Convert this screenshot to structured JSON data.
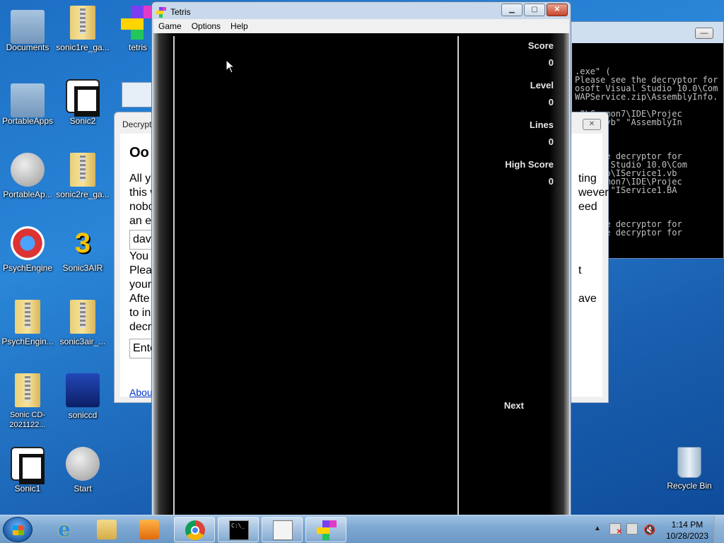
{
  "desktop": {
    "icons": [
      {
        "label": "Documents"
      },
      {
        "label": "sonic1re_ga..."
      },
      {
        "label": "tetris"
      },
      {
        "label": "PortableApps"
      },
      {
        "label": "Sonic2"
      },
      {
        "label": "PortableAp..."
      },
      {
        "label": "sonic2re_ga..."
      },
      {
        "label": "PsychEngine"
      },
      {
        "label": "Sonic3AIR"
      },
      {
        "label": "PsychEngin..."
      },
      {
        "label": "sonic3air_..."
      },
      {
        "label": "Sonic CD-2021122..."
      },
      {
        "label": "soniccd"
      },
      {
        "label": "Sonic1"
      },
      {
        "label": "Start"
      },
      {
        "label": "Recycle Bin"
      }
    ]
  },
  "console": {
    "lines": [
      ".exe\" (",
      "Please see the decryptor for",
      "osoft Visual Studio 10.0\\Com",
      "WAPService.zip\\AssemblyInfo.",
      "",
      ".0\\Common7\\IDE\\Projec",
      "yInfo.vb\" \"AssemblyIn",
      "",
      "",
      "(",
      "see the decryptor for",
      "Visual Studio 10.0\\Com",
      "ice.zip\\IService1.vb",
      ".0\\Common7\\IDE\\Projec",
      "e1.vb\" \"IService1.BA",
      "",
      "",
      "(",
      "see the decryptor for",
      "see the decryptor for"
    ]
  },
  "decryptor": {
    "title": "Decrypt",
    "heading": "Oo",
    "text_left": [
      "All yo",
      "this w",
      "nobo",
      "an e"
    ],
    "field1": "dave",
    "text_left2": [
      "You",
      "Plea",
      "your",
      "Afte",
      "to in",
      "decr"
    ],
    "field2": "Ente",
    "link": "Abou",
    "text_right": [
      "ting",
      "wever,",
      "eed",
      "",
      "",
      "t",
      "",
      "ave"
    ]
  },
  "tetris": {
    "title": "Tetris",
    "menu": [
      "Game",
      "Options",
      "Help"
    ],
    "stats": [
      {
        "label": "Score",
        "value": "0"
      },
      {
        "label": "Level",
        "value": "0"
      },
      {
        "label": "Lines",
        "value": "0"
      },
      {
        "label": "High Score",
        "value": "0"
      }
    ],
    "next_label": "Next"
  },
  "taskbar": {
    "time": "1:14 PM",
    "date": "10/28/2023"
  }
}
